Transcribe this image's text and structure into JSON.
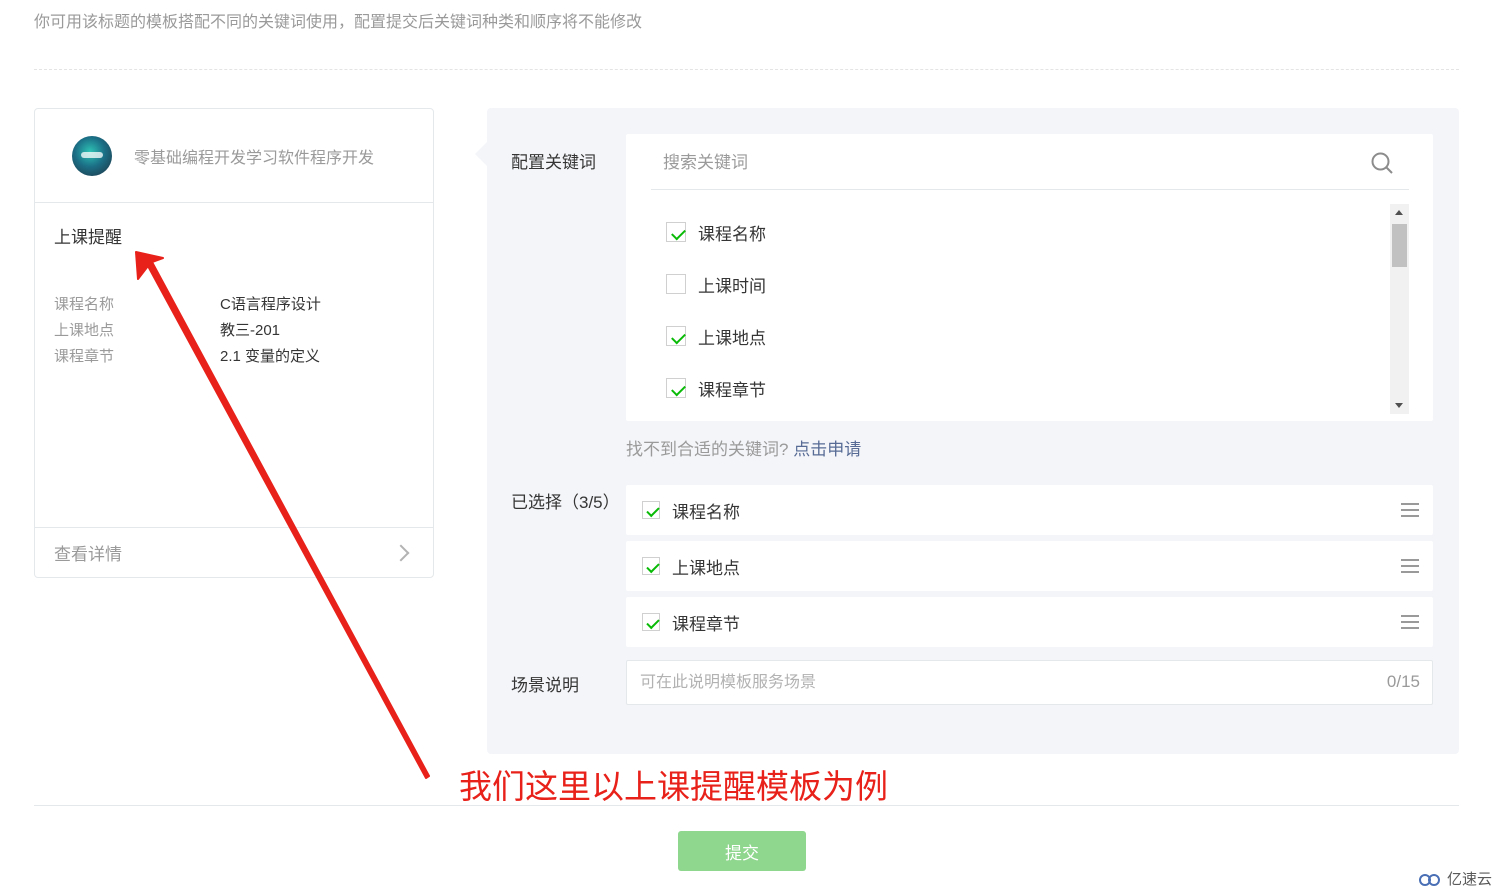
{
  "header": {
    "hint": "你可用该标题的模板搭配不同的关键词使用，配置提交后关键词种类和顺序将不能修改"
  },
  "preview": {
    "app_name": "零基础编程开发学习软件程序开发",
    "title": "上课提醒",
    "fields": [
      {
        "label": "课程名称",
        "value": "C语言程序设计"
      },
      {
        "label": "上课地点",
        "value": "教三-201"
      },
      {
        "label": "课程章节",
        "value": "2.1 变量的定义"
      }
    ],
    "detail_link": "查看详情"
  },
  "config": {
    "keywords_label": "配置关键词",
    "search_placeholder": "搜索关键词",
    "keywords": [
      {
        "label": "课程名称",
        "checked": true
      },
      {
        "label": "上课时间",
        "checked": false
      },
      {
        "label": "上课地点",
        "checked": true
      },
      {
        "label": "课程章节",
        "checked": true
      }
    ],
    "not_found_text": "找不到合适的关键词?",
    "apply_link": "点击申请",
    "selected_label": "已选择（3/5）",
    "selected": [
      {
        "label": "课程名称"
      },
      {
        "label": "上课地点"
      },
      {
        "label": "课程章节"
      }
    ],
    "scene_label": "场景说明",
    "scene_placeholder": "可在此说明模板服务场景",
    "scene_counter": "0/15"
  },
  "annotation": {
    "text": "我们这里以上课提醒模板为例",
    "color": "#e8211a"
  },
  "actions": {
    "submit_label": "提交"
  },
  "watermark": {
    "text": "亿速云"
  },
  "colors": {
    "accent_green": "#09bb07",
    "link_blue": "#576b95",
    "submit_disabled": "#8fd68f"
  }
}
